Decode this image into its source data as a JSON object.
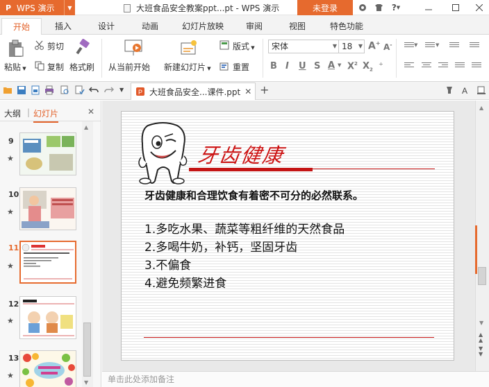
{
  "app": {
    "name": "WPS 演示",
    "logo": "P"
  },
  "window": {
    "title": "大班食品安全教案ppt...pt - WPS 演示",
    "login_label": "未登录",
    "help_label": "?"
  },
  "ribbon_tabs": [
    "开始",
    "插入",
    "设计",
    "动画",
    "幻灯片放映",
    "审阅",
    "视图",
    "特色功能"
  ],
  "ribbon": {
    "paste_label": "粘贴",
    "cut_label": "剪切",
    "copy_label": "复制",
    "format_painter_label": "格式刷",
    "from_current_label": "从当前开始",
    "new_slide_label": "新建幻灯片",
    "layout_label": "版式",
    "reset_label": "重置",
    "font_name": "宋体",
    "font_size": "18"
  },
  "file_tab": {
    "label": "大班食品安全...课件.ppt"
  },
  "left_panel": {
    "tab_outline": "大纲",
    "tab_slides": "幻灯片",
    "slides": [
      {
        "number": "9"
      },
      {
        "number": "10"
      },
      {
        "number": "11"
      },
      {
        "number": "12"
      },
      {
        "number": "13"
      }
    ]
  },
  "slide": {
    "title": "牙齿健康",
    "subtitle": "牙齿健康和合理饮食有着密不可分的必然联系。",
    "points": [
      "1.多吃水果、蔬菜等粗纤维的天然食品",
      "2.多喝牛奶，补钙，坚固牙齿",
      "3.不偏食",
      "4.避免频繁进食"
    ]
  },
  "notes_placeholder": "单击此处添加备注",
  "colors": {
    "accent": "#e66a2e",
    "title_red": "#cc1111",
    "tab_active": "#e3622a"
  }
}
